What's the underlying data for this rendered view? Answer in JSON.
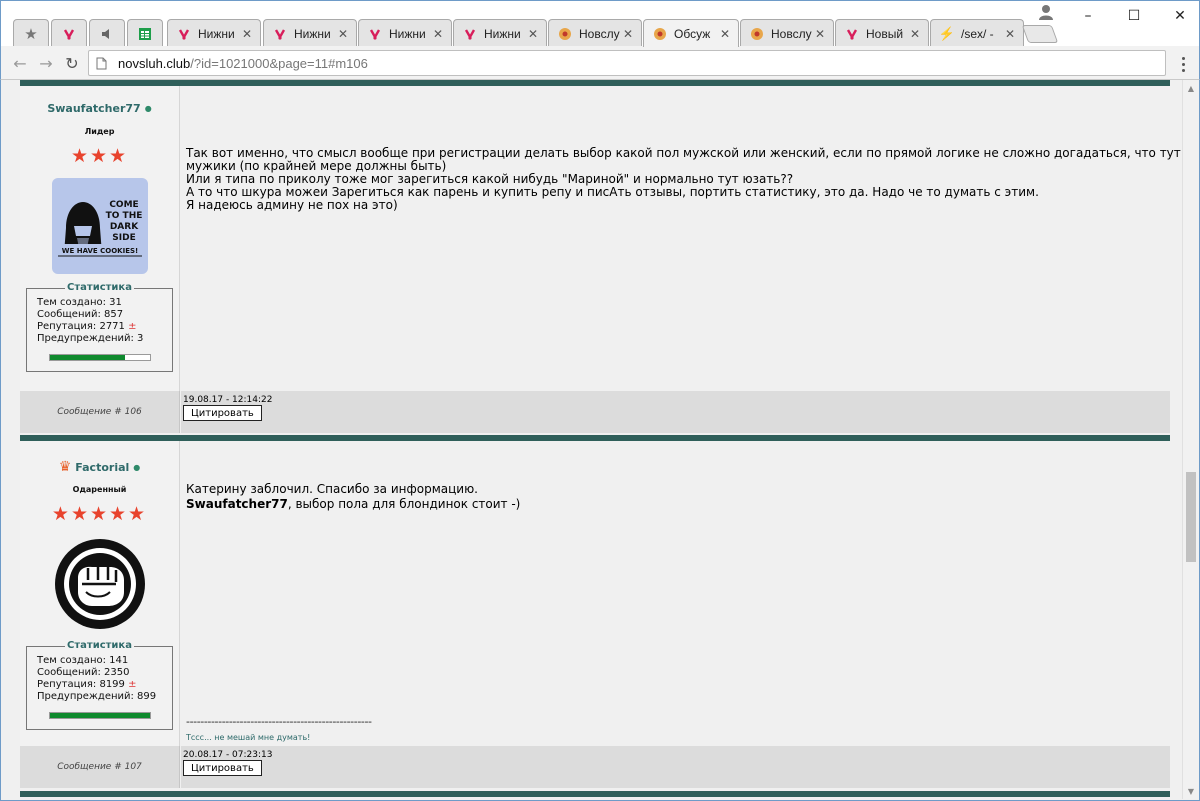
{
  "browser": {
    "tabs": [
      {
        "title": "",
        "icon": "bookmark-star-icon",
        "pinned": true
      },
      {
        "title": "",
        "icon": "site-logo-icon",
        "pinned": true
      },
      {
        "title": "",
        "icon": "speaker-icon",
        "pinned": true
      },
      {
        "title": "",
        "icon": "sheets-icon",
        "pinned": true
      },
      {
        "title": "Нижни",
        "icon": "site-logo-icon"
      },
      {
        "title": "Нижни",
        "icon": "site-logo-icon"
      },
      {
        "title": "Нижни",
        "icon": "site-logo-icon"
      },
      {
        "title": "Нижни",
        "icon": "site-logo-icon"
      },
      {
        "title": "Новслу",
        "icon": "forum-icon"
      },
      {
        "title": "Обсуж",
        "icon": "forum-icon",
        "active": true
      },
      {
        "title": "Новслу",
        "icon": "forum-icon"
      },
      {
        "title": "Новый",
        "icon": "site-logo-icon"
      },
      {
        "title": "/sex/ -",
        "icon": "lightning-icon"
      }
    ],
    "url_host": "novsluh.club",
    "url_rest": "/?id=1021000&page=11#m106",
    "win_min": "–",
    "win_max": "☐",
    "win_close": "✕"
  },
  "posts": [
    {
      "author": "Swaufatcher77",
      "online_mark": "●",
      "rank": "Лидер",
      "stars": "★★★",
      "avatar_text": [
        "COME",
        "TO THE",
        "DARK",
        "SIDE",
        "WE HAVE COOKIES!"
      ],
      "stats_title": "Статистика",
      "stats": {
        "topics": "Тем создано: 31",
        "messages": "Сообщений: 857",
        "reputation": "Репутация: 2771",
        "warnings": "Предупреждений: 3"
      },
      "rep_sign": "±",
      "activity": 0.75,
      "lines": [
        "Так вот именно, что смысл вообще при регистрации делать выбор какой пол мужской или женский, если по прямой логике не сложно догадаться, что тут одни",
        "мужики (по крайней мере должны быть)",
        "Или я типа по приколу тоже мог зарегиться какой нибудь \"Мариной\" и нормально тут юзать??",
        "А то что шкура можеи Зарегиться как парень и купить репу и писАть отзывы, портить статистику, это да. Надо че то думать с этим.",
        "Я надеюсь админу не пох на это)"
      ],
      "msg_no": "Сообщение # 106",
      "date": "19.08.17 - 12:14:22",
      "quote": "Цитировать"
    },
    {
      "author": "Factorial",
      "online_mark": "●",
      "crown": "♛",
      "rank": "Одаренный",
      "stars": "★★★★★",
      "stats_title": "Статистика",
      "stats": {
        "topics": "Тем создано: 141",
        "messages": "Сообщений: 2350",
        "reputation": "Репутация: 8199",
        "warnings": "Предупреждений: 899"
      },
      "rep_sign": "±",
      "activity": 1.0,
      "line1": "Катерину заблочил. Спасибо за информацию.",
      "mention": "Swaufatcher77",
      "line2_rest": ", выбор пола для блондинок стоит -)",
      "dashes": "----------------------------------------------------",
      "signature": "Тссс... не мешай мне думать!",
      "msg_no": "Сообщение # 107",
      "date": "20.08.17 - 07:23:13",
      "quote": "Цитировать"
    }
  ]
}
